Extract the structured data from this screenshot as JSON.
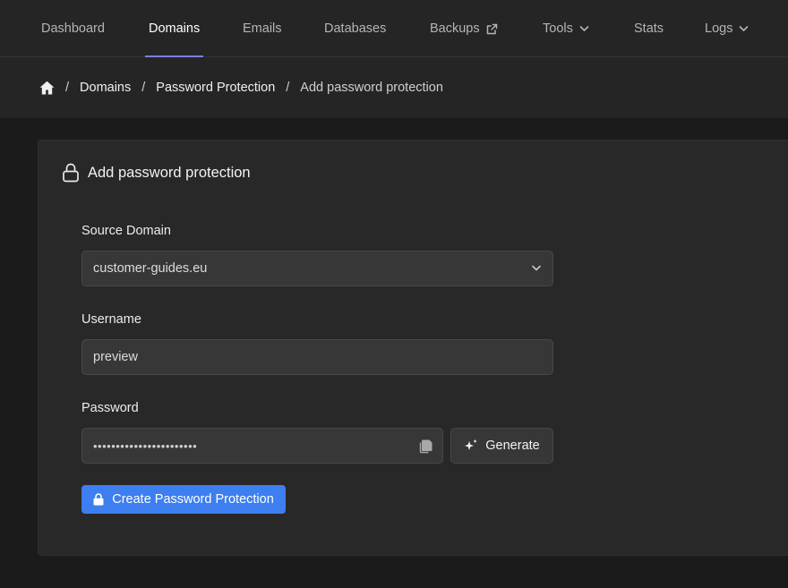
{
  "nav": {
    "items": [
      {
        "label": "Dashboard"
      },
      {
        "label": "Domains"
      },
      {
        "label": "Emails"
      },
      {
        "label": "Databases"
      },
      {
        "label": "Backups"
      },
      {
        "label": "Tools"
      },
      {
        "label": "Stats"
      },
      {
        "label": "Logs"
      }
    ],
    "active": "Domains",
    "accent_color": "#7b7ff0"
  },
  "breadcrumb": {
    "items": [
      "Domains",
      "Password Protection"
    ],
    "current": "Add password protection"
  },
  "form": {
    "title": "Add password protection",
    "source_domain": {
      "label": "Source Domain",
      "value": "customer-guides.eu"
    },
    "username": {
      "label": "Username",
      "value": "preview"
    },
    "password": {
      "label": "Password",
      "masked_value": "•••••••••••••••••••••••"
    },
    "generate_label": "Generate",
    "submit_label": "Create Password Protection",
    "submit_color": "#3d7ef0"
  },
  "icons": {
    "home": "home-icon",
    "external": "external-link-icon",
    "chevron": "chevron-down-icon",
    "lock": "lock-icon",
    "copy": "copy-icon",
    "sparkle": "sparkle-icon"
  }
}
